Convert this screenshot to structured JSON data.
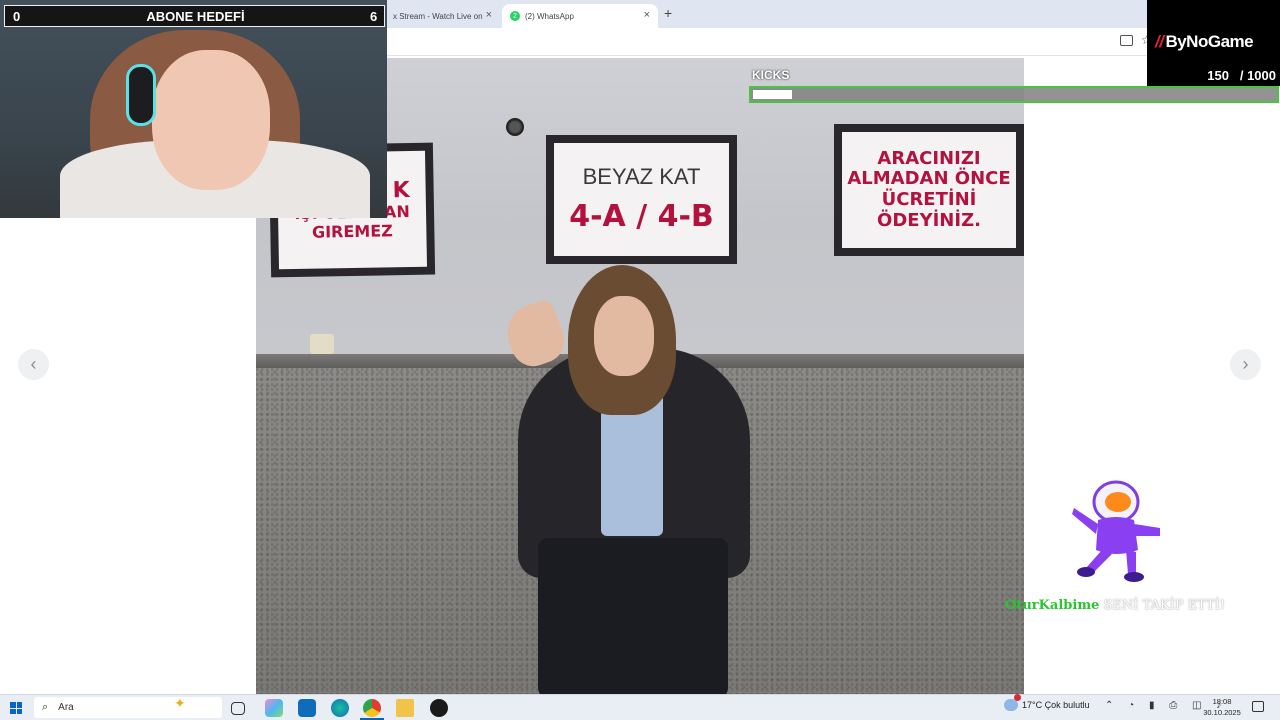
{
  "browser": {
    "tabs": [
      {
        "label": "x Stream - Watch Live on",
        "active": false
      },
      {
        "label": "(2) WhatsApp",
        "badge": "2",
        "active": true
      }
    ],
    "new_tab_glyph": "+",
    "close_glyph": "×"
  },
  "viewer": {
    "prev_glyph": "‹",
    "next_glyph": "›"
  },
  "photo": {
    "sign_left_lines": [
      "K",
      "IŞI OLMAYAN",
      "GIREMEZ"
    ],
    "sign_mid": {
      "floor": "BEYAZ KAT",
      "rooms": "4-A / 4-B"
    },
    "sign_right_lines": [
      "ARACINIZI",
      "ALMADAN ÖNCE",
      "ÜCRETİNİ ÖDEYİNİZ."
    ]
  },
  "overlay": {
    "goal": {
      "left": "0",
      "title": "ABONE HEDEFİ",
      "right": "6"
    },
    "kicks": {
      "label": "KICKS",
      "progress": 0.15
    },
    "brand": {
      "name": "ByNoGame",
      "current": "150",
      "total": "/ 1000"
    },
    "follow_alert": {
      "name": "OturKalbime",
      "message": "SENİ TAKİP ETTİ!"
    }
  },
  "taskbar": {
    "search_placeholder": "Ara",
    "weather": "17°C  Çok bulutlu",
    "tray_glyphs": "⌃ ◔ ▮ ⎙ ◫ ♪",
    "time": "18:08",
    "date": "30.10.2025"
  },
  "colors": {
    "sign_red": "#b3123f",
    "kicks_border": "#48c43f",
    "follow_name": "#29c52f",
    "brand_accent": "#e3242b"
  }
}
